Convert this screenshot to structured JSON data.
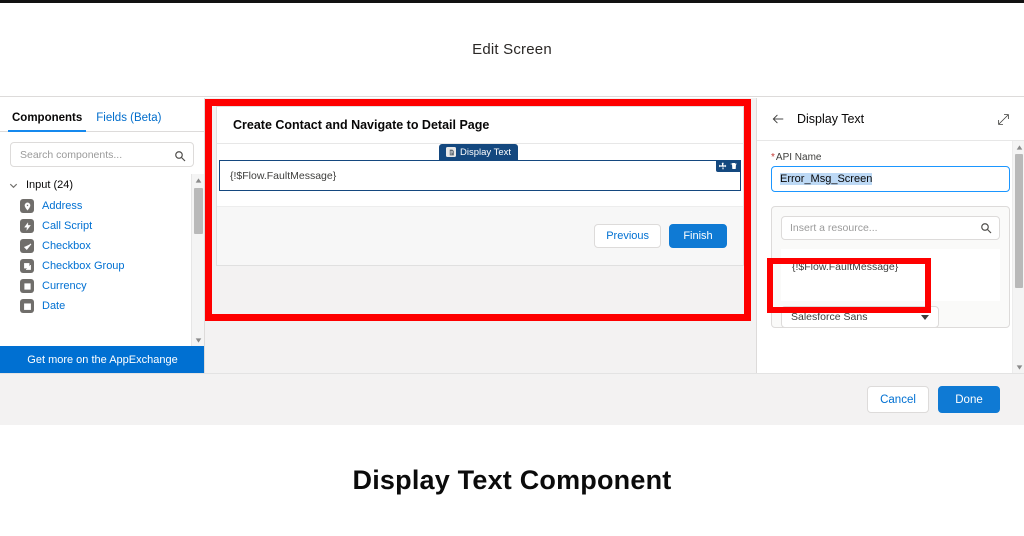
{
  "modal": {
    "title": "Edit Screen"
  },
  "left_panel": {
    "tabs": [
      {
        "label": "Components",
        "active": true
      },
      {
        "label": "Fields (Beta)",
        "active": false
      }
    ],
    "search": {
      "placeholder": "Search components...",
      "value": "",
      "icon": "search-icon"
    },
    "group": {
      "label": "Input (24)",
      "count": 24,
      "expanded": true,
      "chevron_icon": "chevron-down-icon"
    },
    "components": [
      {
        "label": "Address",
        "icon": "location-pin-icon"
      },
      {
        "label": "Call Script",
        "icon": "lightning-bolt-icon"
      },
      {
        "label": "Checkbox",
        "icon": "checkmark-icon"
      },
      {
        "label": "Checkbox Group",
        "icon": "copy-icon"
      },
      {
        "label": "Currency",
        "icon": "square-outline-icon"
      },
      {
        "label": "Date",
        "icon": "calendar-icon"
      }
    ],
    "appexchange_label": "Get more on the AppExchange",
    "scrollbar": {
      "up_icon": "scroll-up-arrow-icon",
      "down_icon": "scroll-down-arrow-icon"
    }
  },
  "canvas": {
    "screen_title": "Create Contact and Navigate to Detail Page",
    "component": {
      "tab_label": "Display Text",
      "tab_icon": "document-icon",
      "value": "{!$Flow.FaultMessage}",
      "actions": [
        {
          "name": "drag-handle-icon"
        },
        {
          "name": "delete-icon"
        }
      ]
    },
    "buttons": [
      {
        "label": "Previous",
        "style": "neutral"
      },
      {
        "label": "Finish",
        "style": "brand"
      }
    ]
  },
  "right_panel": {
    "back_icon": "arrow-left-icon",
    "title": "Display Text",
    "expand_icon": "expand-diagonal-icon",
    "api_name": {
      "label": "API Name",
      "required_marker": "*",
      "value": "Error_Msg_Screen",
      "selected": true
    },
    "resource_picker": {
      "placeholder": "Insert a resource...",
      "icon": "search-icon"
    },
    "rich_text_value": "{!$Flow.FaultMessage}",
    "font_select": {
      "value": "Salesforce Sans",
      "caret_icon": "caret-down-icon"
    },
    "scrollbar": {
      "up_icon": "scroll-up-arrow-icon",
      "down_icon": "scroll-down-arrow-icon"
    }
  },
  "footer": {
    "cancel_label": "Cancel",
    "done_label": "Done"
  },
  "caption": {
    "text": "Display Text Component"
  },
  "colors": {
    "annotation_red": "#fe0000",
    "brand_blue": "#0070d2",
    "link_blue": "#0070d2",
    "tab_dark_blue": "#14487f",
    "required_red": "#c23934"
  }
}
